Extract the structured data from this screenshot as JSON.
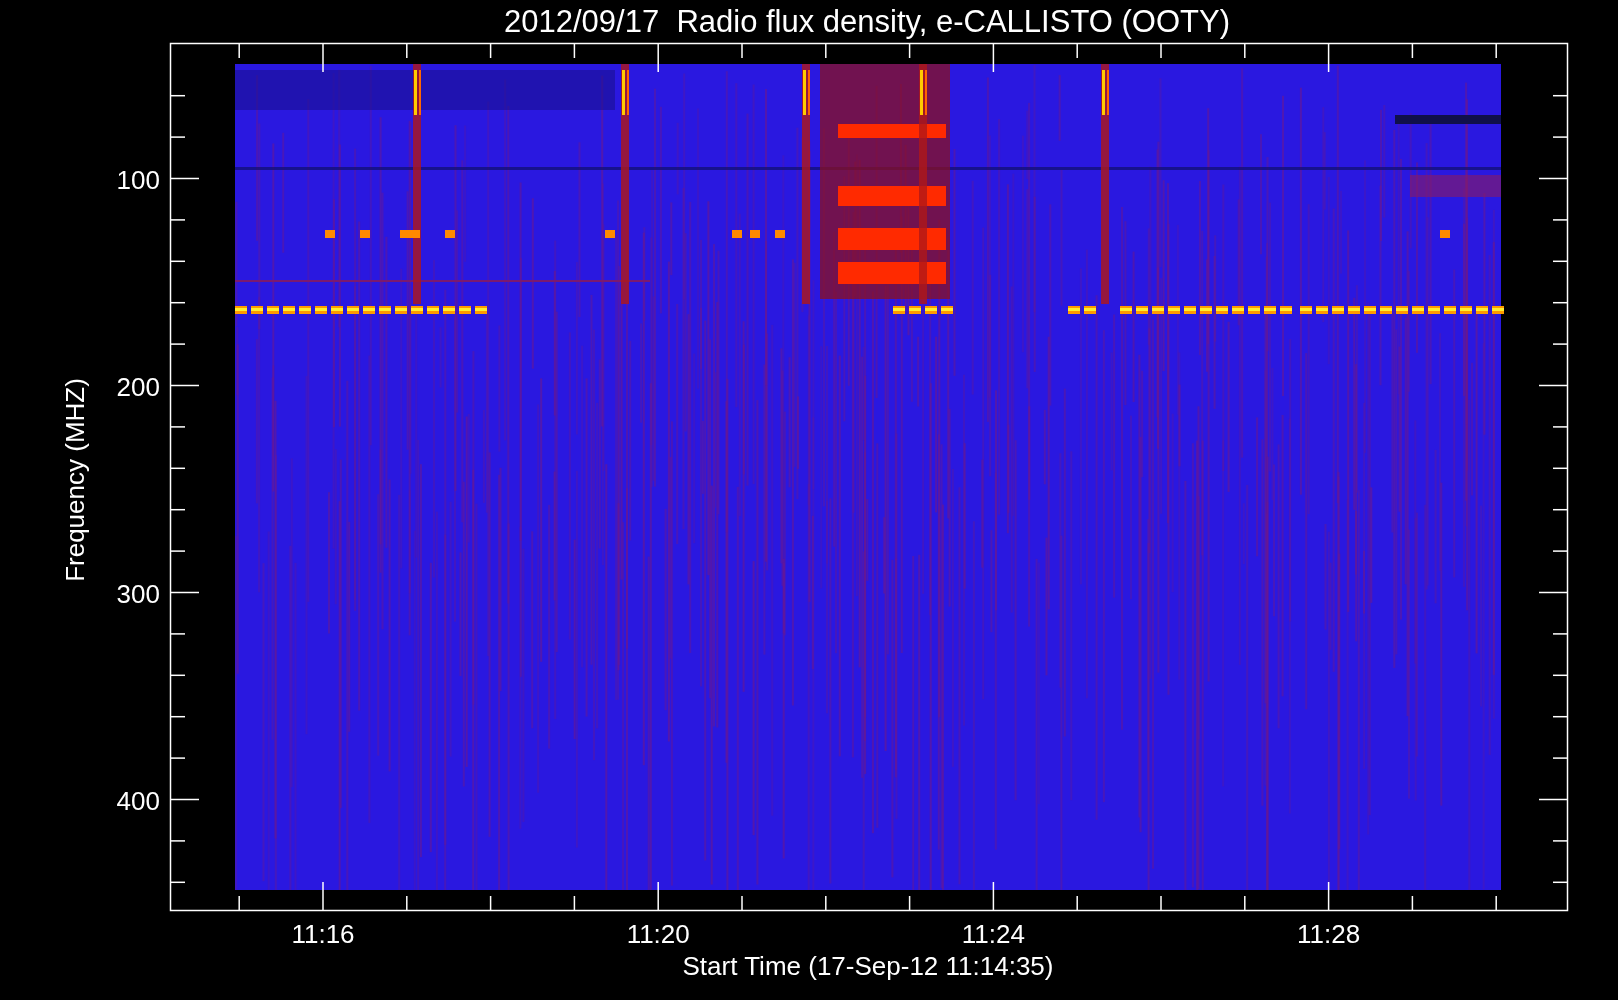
{
  "plot": {
    "title": "2012/09/17  Radio flux density, e-CALLISTO (OOTY)",
    "ylabel": "Frequency (MHZ)",
    "xlabel": "Start Time (17-Sep-12 11:14:35)",
    "yticks": [
      "100",
      "200",
      "300",
      "400"
    ],
    "xticks": [
      "11:16",
      "11:20",
      "11:24",
      "11:28"
    ]
  }
}
